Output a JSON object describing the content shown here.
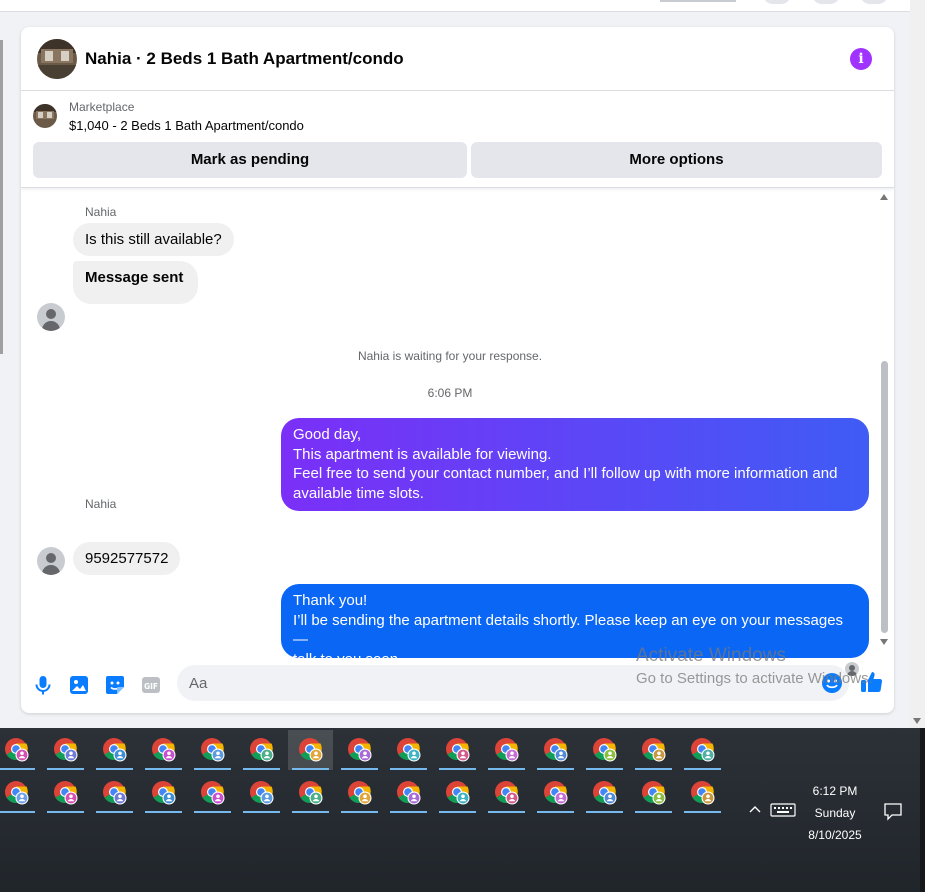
{
  "header": {
    "title": "Nahia · 2 Beds 1 Bath Apartment/condo",
    "info_icon": "info-icon"
  },
  "listing": {
    "source": "Marketplace",
    "title": "$1,040 - 2 Beds 1 Bath Apartment/condo",
    "pending_label": "Mark as pending",
    "more_label": "More options"
  },
  "messages": {
    "sender_1": "Nahia",
    "in_1": "Is this still available?",
    "in_2": "Message sent",
    "waiting_text": "Nahia is waiting for your response.",
    "time": "6:06 PM",
    "out_1_lines": [
      "Good day,",
      "This apartment is available for viewing.",
      "Feel free to send your contact number, and I’ll follow up with more information and",
      "available time slots."
    ],
    "sender_2": "Nahia",
    "in_3": "9592577572",
    "out_2_lines": [
      "Thank you!",
      "I’ll be sending the apartment details shortly. Please keep an eye on your messages—",
      "talk to you soon."
    ]
  },
  "composer": {
    "placeholder": "Aa",
    "icons": [
      "microphone-icon",
      "photo-icon",
      "sticker-icon",
      "gif-icon",
      "emoji-icon",
      "thumbs-up-icon"
    ]
  },
  "watermark": {
    "title": "Activate Windows",
    "subtitle": "Go to Settings to activate Windows."
  },
  "taskbar": {
    "app_name": "Google Chrome",
    "time": "6:12 PM",
    "day": "Sunday",
    "date": "8/10/2025"
  },
  "colors": {
    "out_bubble_1_start": "#7b2ff7",
    "out_bubble_1_end": "#3f5cf5",
    "out_bubble_2": "#0a66f5",
    "info_accent": "#a033ff",
    "messenger_blue": "#0a7cff"
  }
}
